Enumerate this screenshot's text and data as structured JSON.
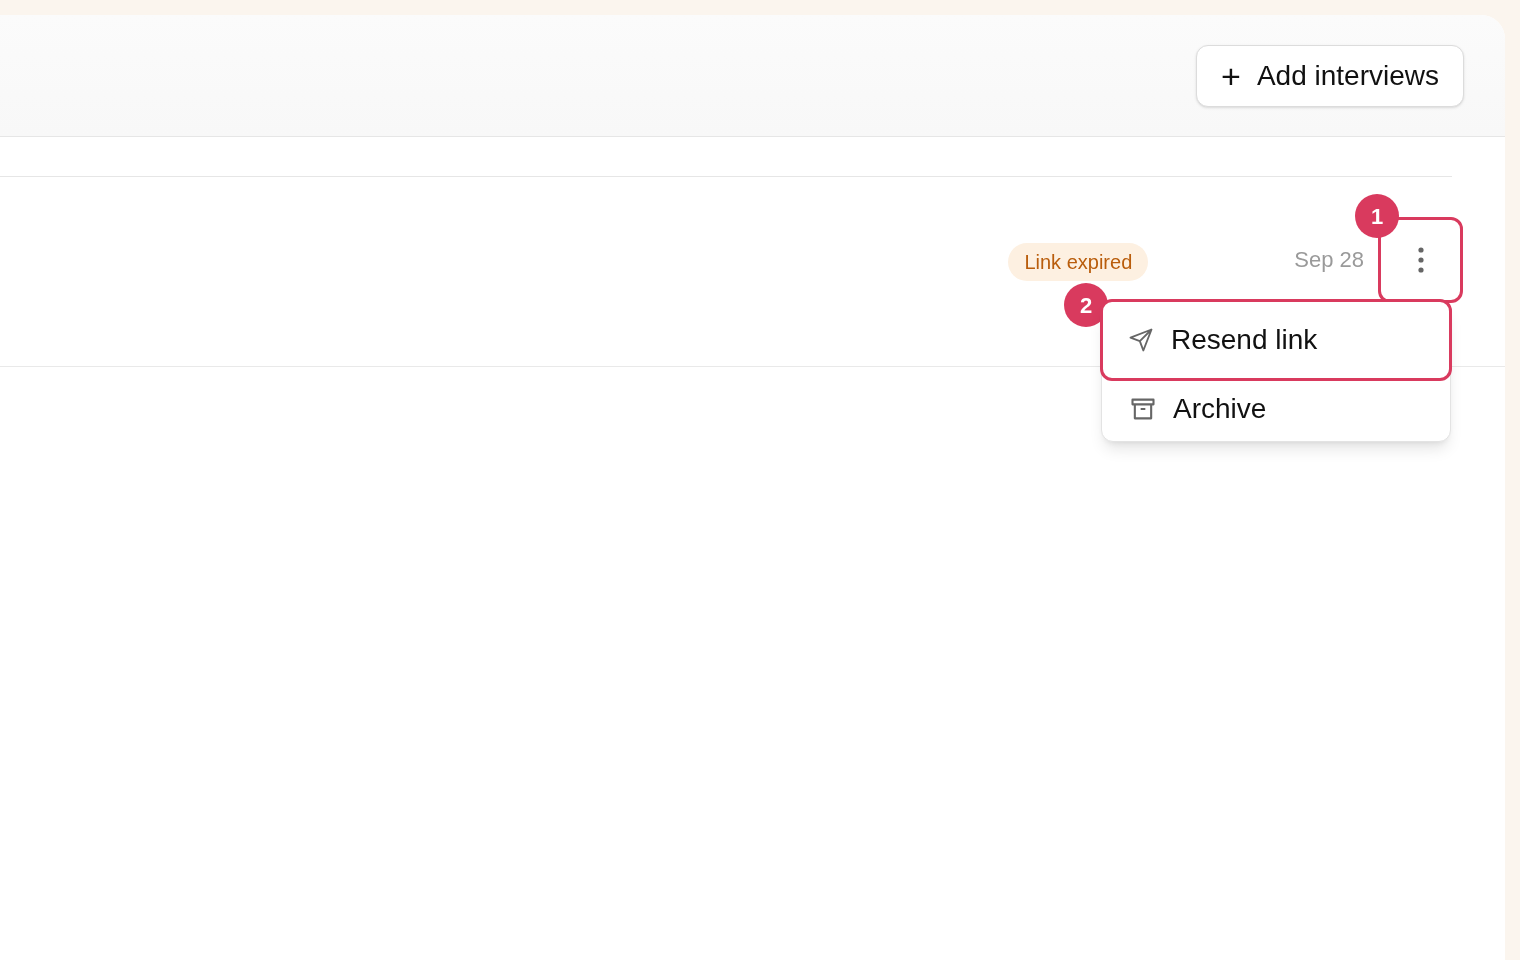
{
  "header": {
    "add_button": {
      "icon": "+",
      "label": "Add interviews"
    }
  },
  "rows": [
    {
      "status": "Link expired",
      "date": "Sep 28",
      "menu_open": true
    }
  ],
  "menu": {
    "items": [
      {
        "kind": "send",
        "label": "Resend link",
        "highlighted": true
      },
      {
        "kind": "archive",
        "label": "Archive",
        "highlighted": false
      }
    ]
  },
  "annotations": [
    {
      "label": "1"
    },
    {
      "label": "2"
    }
  ]
}
